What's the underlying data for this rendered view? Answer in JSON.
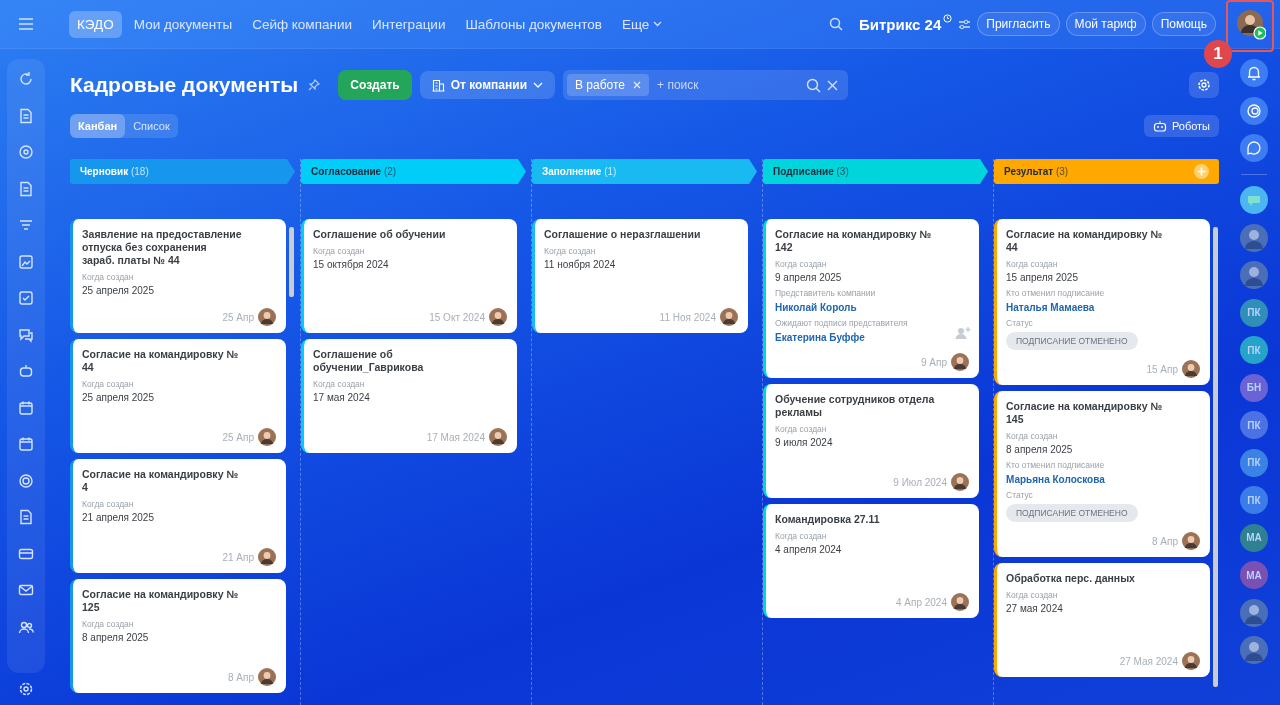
{
  "topbar": {
    "tabs": [
      {
        "label": "КЭДО",
        "selected": true
      },
      {
        "label": "Мои документы",
        "selected": false
      },
      {
        "label": "Сейф компании",
        "selected": false
      },
      {
        "label": "Интеграции",
        "selected": false
      },
      {
        "label": "Шаблоны документов",
        "selected": false
      }
    ],
    "more": "Еще",
    "logo": "Битрикс 24",
    "buttons": [
      "Пригласить",
      "Мой тариф",
      "Помощь"
    ],
    "annotation": "1"
  },
  "header": {
    "title": "Кадровые документы",
    "create": "Создать",
    "filter": "От компании",
    "search": {
      "chips": [
        "В работе"
      ],
      "placeholder": "+ поиск"
    },
    "views": [
      {
        "label": "Канбан",
        "selected": true
      },
      {
        "label": "Список",
        "selected": false
      }
    ],
    "robots": "Роботы"
  },
  "columns": [
    {
      "name": "Черновик",
      "count": "(18)",
      "color": "#1796ee",
      "scrollbar": true,
      "cards": [
        {
          "title": "Заявление на предоставление отпуска без сохранения зараб. платы № 44",
          "fields": [
            {
              "kind": "date",
              "label": "Когда создан",
              "value": "25 апреля 2025"
            }
          ],
          "date": "25 Апр",
          "action_icon": false
        },
        {
          "title": "Согласие на командировку № 44",
          "fields": [
            {
              "kind": "date",
              "label": "Когда создан",
              "value": "25 апреля 2025"
            }
          ],
          "date": "25 Апр",
          "action_icon": false
        },
        {
          "title": "Согласие на командировку № 4",
          "fields": [
            {
              "kind": "date",
              "label": "Когда создан",
              "value": "21 апреля 2025"
            }
          ],
          "date": "21 Апр",
          "action_icon": false
        },
        {
          "title": "Согласие на командировку № 125",
          "fields": [
            {
              "kind": "date",
              "label": "Когда создан",
              "value": "8 апреля 2025"
            }
          ],
          "date": "8 Апр",
          "action_icon": false
        }
      ]
    },
    {
      "name": "Согласование",
      "count": "(2)",
      "color": "#00cdf8",
      "scrollbar": false,
      "cards": [
        {
          "title": "Соглашение об обучении",
          "fields": [
            {
              "kind": "date",
              "label": "Когда создан",
              "value": "15 октября 2024"
            }
          ],
          "date": "15 Окт 2024",
          "action_icon": false
        },
        {
          "title": "Соглашение об обучении_Гаврикова",
          "fields": [
            {
              "kind": "date",
              "label": "Когда создан",
              "value": "17 мая 2024"
            }
          ],
          "date": "17 Мая 2024",
          "action_icon": false
        }
      ]
    },
    {
      "name": "Заполнение",
      "count": "(1)",
      "color": "#19b9f2",
      "scrollbar": false,
      "cards": [
        {
          "title": "Соглашение о неразглашении",
          "fields": [
            {
              "kind": "date",
              "label": "Когда создан",
              "value": "11 ноября 2024"
            }
          ],
          "date": "11 Ноя 2024",
          "action_icon": false
        }
      ]
    },
    {
      "name": "Подписание",
      "count": "(3)",
      "color": "#00d5dc",
      "scrollbar": false,
      "cards": [
        {
          "title": "Согласие на командировку № 142",
          "fields": [
            {
              "kind": "date",
              "label": "Когда создан",
              "value": "9 апреля 2025"
            },
            {
              "kind": "person",
              "label": "Представитель компании",
              "value": "Николай Король"
            },
            {
              "kind": "person",
              "label": "Ожидают подписи представителя",
              "value": "Екатерина Буффе"
            }
          ],
          "date": "9 Апр",
          "action_icon": true
        },
        {
          "title": "Обучение сотрудников отдела рекламы",
          "fields": [
            {
              "kind": "date",
              "label": "Когда создан",
              "value": "9 июля 2024"
            }
          ],
          "date": "9 Июл 2024",
          "action_icon": false
        },
        {
          "title": "Командировка 27.11",
          "fields": [
            {
              "kind": "date",
              "label": "Когда создан",
              "value": "4 апреля 2024"
            }
          ],
          "date": "4 Апр 2024",
          "action_icon": false
        }
      ]
    },
    {
      "name": "Результат",
      "count": "(3)",
      "color": "#ffa800",
      "scrollbar": true,
      "cards": [
        {
          "title": "Согласие на командировку № 44",
          "fields": [
            {
              "kind": "date",
              "label": "Когда создан",
              "value": "15 апреля 2025"
            },
            {
              "kind": "person",
              "label": "Кто отменил подписание",
              "value": "Наталья Мамаева"
            },
            {
              "kind": "status",
              "label": "Статус",
              "value": "ПОДПИСАНИЕ ОТМЕНЕНО"
            }
          ],
          "date": "15 Апр",
          "action_icon": false
        },
        {
          "title": "Согласие на командировку № 145",
          "fields": [
            {
              "kind": "date",
              "label": "Когда создан",
              "value": "8 апреля 2025"
            },
            {
              "kind": "person",
              "label": "Кто отменил подписание",
              "value": "Марьяна Колоскова"
            },
            {
              "kind": "status",
              "label": "Статус",
              "value": "ПОДПИСАНИЕ ОТМЕНЕНО"
            }
          ],
          "date": "8 Апр",
          "action_icon": false
        },
        {
          "title": "Обработка перс. данных",
          "fields": [
            {
              "kind": "date",
              "label": "Когда создан",
              "value": "27 мая 2024"
            }
          ],
          "date": "27 Мая 2024",
          "action_icon": false
        }
      ]
    }
  ],
  "right_sidebar": {
    "avatars": [
      {
        "kind": "photo"
      },
      {
        "kind": "photo"
      },
      {
        "kind": "initials",
        "text": "ПК",
        "color": "#2f8fb8"
      },
      {
        "kind": "initials",
        "text": "ПК",
        "color": "#25a3c8"
      },
      {
        "kind": "initials",
        "text": "БН",
        "color": "#6a63d6"
      },
      {
        "kind": "initials",
        "text": "ПК",
        "color": "#4a72e4"
      },
      {
        "kind": "initials",
        "text": "ПК",
        "color": "#3a82e6"
      },
      {
        "kind": "initials",
        "text": "ПК",
        "color": "#3a7ce8"
      },
      {
        "kind": "initials",
        "text": "МА",
        "color": "#2f8090"
      },
      {
        "kind": "initials",
        "text": "МА",
        "color": "#7a50b4"
      },
      {
        "kind": "photo"
      },
      {
        "kind": "photo"
      }
    ]
  }
}
